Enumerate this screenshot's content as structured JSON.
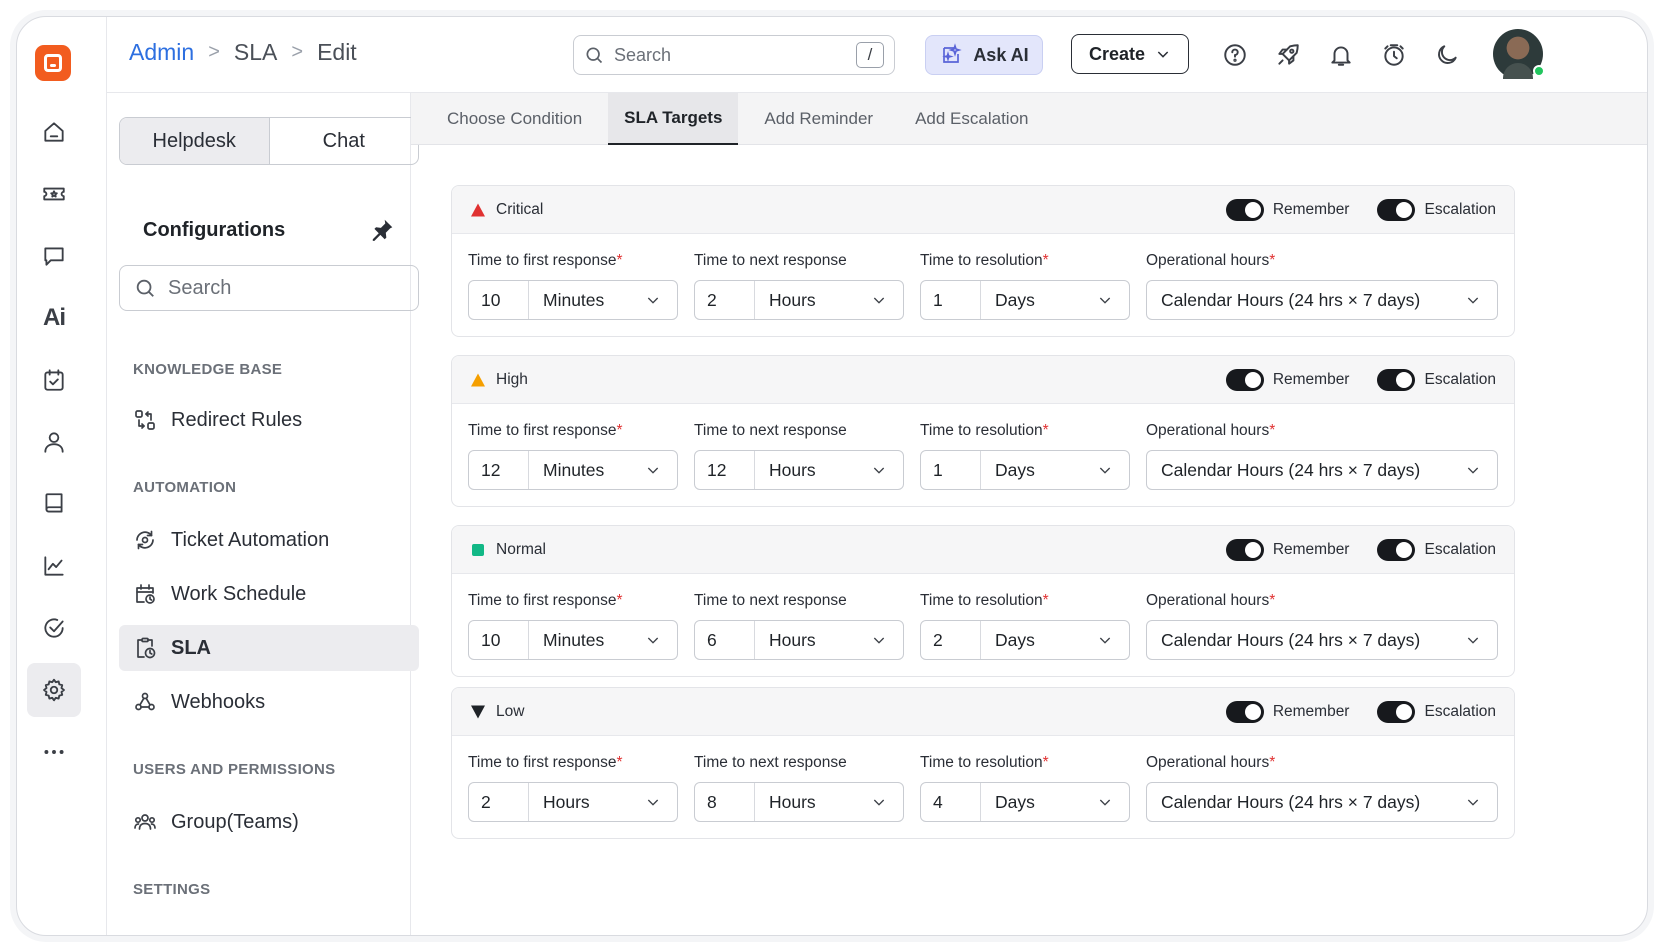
{
  "breadcrumb": {
    "admin": "Admin",
    "sla": "SLA",
    "edit": "Edit"
  },
  "header": {
    "search_placeholder": "Search",
    "search_shortcut": "/",
    "ask_ai_label": "Ask AI",
    "create_label": "Create"
  },
  "sidebar": {
    "tab_helpdesk": "Helpdesk",
    "tab_chat": "Chat",
    "title": "Configurations",
    "search_placeholder": "Search",
    "sections": {
      "knowledge_base": "KNOWLEDGE BASE",
      "automation": "AUTOMATION",
      "users": "USERS AND PERMISSIONS",
      "settings": "SETTINGS"
    },
    "items": {
      "redirect_rules": "Redirect Rules",
      "ticket_automation": "Ticket Automation",
      "work_schedule": "Work Schedule",
      "sla": "SLA",
      "webhooks": "Webhooks",
      "group_teams": "Group(Teams)"
    }
  },
  "tabs": [
    "Choose Condition",
    "SLA Targets",
    "Add Reminder",
    "Add Escalation"
  ],
  "labels": {
    "first_response": "Time to first response",
    "next_response": "Time to next response",
    "resolution": "Time to resolution",
    "operational_hours": "Operational hours",
    "required_mark": "*",
    "remember": "Remember",
    "escalation": "Escalation"
  },
  "colors": {
    "critical": "#e03131",
    "high": "#f59f00",
    "normal": "#12b886",
    "low": "#1f2328",
    "brand": "#f25c1f",
    "link": "#2d6fe0"
  },
  "priorities": [
    {
      "name": "Critical",
      "icon": "triangle-up-icon",
      "first_value": "10",
      "first_unit": "Minutes",
      "next_value": "2",
      "next_unit": "Hours",
      "res_value": "1",
      "res_unit": "Days",
      "operational": "Calendar Hours (24 hrs × 7 days)"
    },
    {
      "name": "High",
      "icon": "triangle-up-icon",
      "first_value": "12",
      "first_unit": "Minutes",
      "next_value": "12",
      "next_unit": "Hours",
      "res_value": "1",
      "res_unit": "Days",
      "operational": "Calendar Hours (24 hrs × 7 days)"
    },
    {
      "name": "Normal",
      "icon": "square-icon",
      "first_value": "10",
      "first_unit": "Minutes",
      "next_value": "6",
      "next_unit": "Hours",
      "res_value": "2",
      "res_unit": "Days",
      "operational": "Calendar Hours (24 hrs × 7 days)"
    },
    {
      "name": "Low",
      "icon": "triangle-down-icon",
      "first_value": "2",
      "first_unit": "Hours",
      "next_value": "8",
      "next_unit": "Hours",
      "res_value": "4",
      "res_unit": "Days",
      "operational": "Calendar Hours (24 hrs × 7 days)"
    }
  ]
}
